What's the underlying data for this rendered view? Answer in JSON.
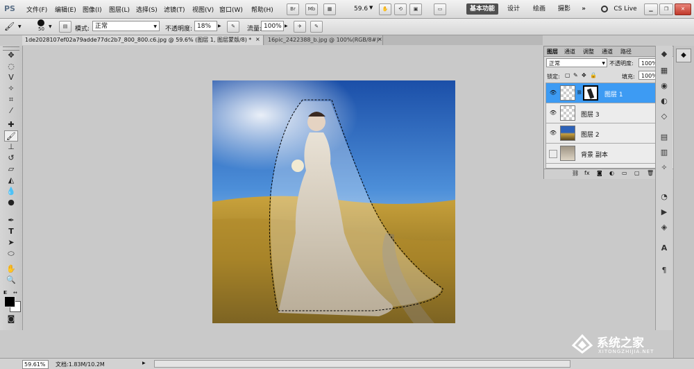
{
  "app": {
    "logo": "PS"
  },
  "menu": [
    "文件(F)",
    "编辑(E)",
    "图像(I)",
    "图层(L)",
    "选择(S)",
    "滤镜(T)",
    "视图(V)",
    "窗口(W)",
    "帮助(H)"
  ],
  "appbar": {
    "br_label": "Br",
    "mb_label": "Mb",
    "zoom_value": "59.6",
    "workspaces": [
      "基本功能",
      "设计",
      "绘画",
      "摄影"
    ],
    "more_label": "»",
    "cs_live": "CS Live"
  },
  "options": {
    "brush_size": "50",
    "mode_label": "模式:",
    "mode_value": "正常",
    "opacity_label": "不透明度:",
    "opacity_value": "18%",
    "flow_label": "流量:",
    "flow_value": "100%"
  },
  "tabs": [
    "1de2028107ef02a79adde77dc2b7_800_800.c6.jpg @ 59.6% (图层 1, 图层蒙版/8) *",
    "16pic_2422388_b.jpg @ 100%(RGB/8#)"
  ],
  "tab_close": "×",
  "layers_panel": {
    "tabs": [
      "图层",
      "通道",
      "调整",
      "通道",
      "路径"
    ],
    "blend_mode": "正常",
    "opacity_label": "不透明度:",
    "opacity_value": "100%",
    "lock_label": "锁定:",
    "fill_label": "填充:",
    "fill_value": "100%",
    "layers": [
      {
        "name": "图层 1",
        "visible": true,
        "selected": true
      },
      {
        "name": "图层 3",
        "visible": true,
        "selected": false
      },
      {
        "name": "图层 2",
        "visible": true,
        "selected": false
      },
      {
        "name": "背景 副本",
        "visible": false,
        "selected": false
      }
    ]
  },
  "status": {
    "zoom": "59.61%",
    "doc_info": "文档:1.83M/10.2M"
  },
  "watermark": {
    "brand": "系统之家",
    "url": "XITONGZHIJIA.NET"
  },
  "colors": {
    "selection_blue": "#3d9bf3",
    "ps_active_ws": "#505050"
  }
}
